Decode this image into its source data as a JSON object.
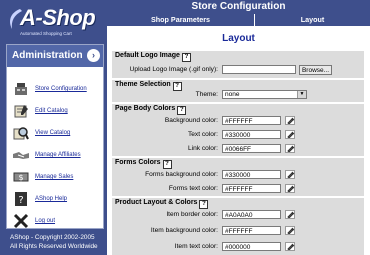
{
  "logo": {
    "text": "A-Shop",
    "tagline": "Automated Shopping Cart"
  },
  "sidebar": {
    "title": "Administration",
    "items": [
      {
        "label": "Store Configuration",
        "icon": "cash-register-icon"
      },
      {
        "label": "Edit Catalog",
        "icon": "catalog-book-icon"
      },
      {
        "label": "View Catalog",
        "icon": "magnifier-icon"
      },
      {
        "label": "Manage Affiliates",
        "icon": "handshake-icon"
      },
      {
        "label": "Manage Sales",
        "icon": "money-icon"
      },
      {
        "label": "AShop Help",
        "icon": "help-book-icon"
      },
      {
        "label": "Log out",
        "icon": "close-x-icon"
      }
    ],
    "copyright_1": "AShop - Copyright 2002-2005",
    "copyright_2": "All Rights Reserved Worldwide"
  },
  "header": {
    "title": "Store Configuration"
  },
  "tabs": [
    "Shop Parameters",
    "Layout"
  ],
  "page_title": "Layout",
  "sections": {
    "logo": {
      "title": "Default Logo Image",
      "upload_label": "Upload Logo Image (.gif only):",
      "browse_label": "Browse..."
    },
    "theme": {
      "title": "Theme Selection",
      "theme_label": "Theme:",
      "theme_value": "none"
    },
    "body_colors": {
      "title": "Page Body Colors",
      "bg_label": "Background color:",
      "bg_value": "#FFFFFF",
      "text_label": "Text color:",
      "text_value": "#330000",
      "link_label": "Link color:",
      "link_value": "#0066FF"
    },
    "forms_colors": {
      "title": "Forms Colors",
      "bg_label": "Forms background color:",
      "bg_value": "#330000",
      "text_label": "Forms text color:",
      "text_value": "#FFFFFF"
    },
    "product_layout": {
      "title": "Product Layout & Colors",
      "border_label": "Item border color:",
      "border_value": "#A0A0A0",
      "bg_label": "Item background color:",
      "bg_value": "#FFFFFF",
      "text_label": "Item text color:",
      "text_value": "#000000"
    }
  },
  "help_glyph": "?",
  "colors": {
    "sidebar_bg": "#3E4F8C",
    "header_bg": "#3E4F8C",
    "link": "#1a2a99",
    "section_bg": "#dcdcdc"
  }
}
